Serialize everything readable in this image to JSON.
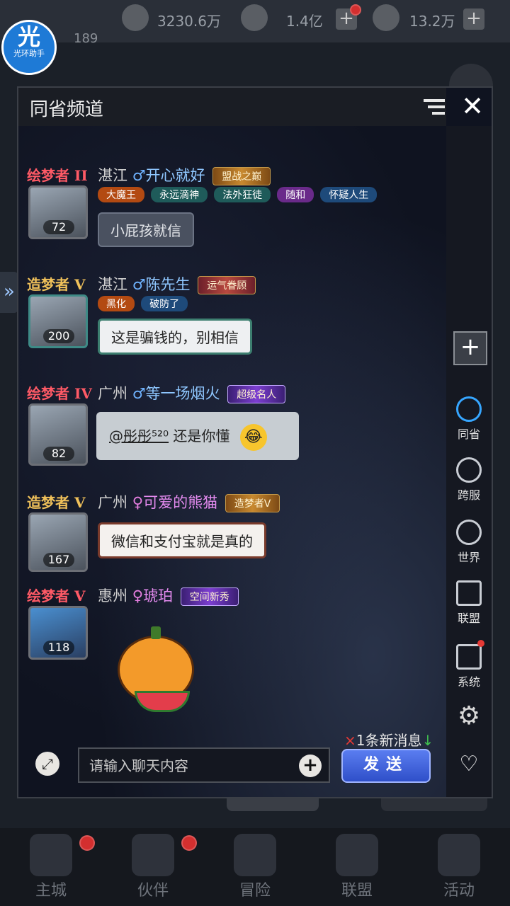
{
  "topbar": {
    "power": "3230.6万",
    "gold": "1.4亿",
    "diamond": "13.2万",
    "level": "189"
  },
  "helper": {
    "icon_text": "光",
    "label": "光环助手"
  },
  "panel": {
    "title": "同省频道"
  },
  "messages": [
    {
      "rank": "绘梦者 II",
      "rank_color": "#ff5a66",
      "city": "湛江",
      "sex": "♂",
      "name": "开心就好",
      "title": "盟战之巅",
      "tags": [
        "大魔王",
        "永远滴神",
        "法外狂徒",
        "随和",
        "怀疑人生"
      ],
      "level": "72",
      "text": "小屁孩就信"
    },
    {
      "rank": "造梦者 V",
      "rank_color": "#f0c15a",
      "city": "湛江",
      "sex": "♂",
      "name": "陈先生",
      "title": "运气眷顾",
      "tags": [
        "黑化",
        "破防了"
      ],
      "level": "200",
      "text": "这是骗钱的，别相信"
    },
    {
      "rank": "绘梦者 IV",
      "rank_color": "#ff5a66",
      "city": "广州",
      "sex": "♂",
      "name": "等一场烟火",
      "title": "超级名人",
      "tags": [],
      "level": "82",
      "mention": "@彤彤⁵²⁰",
      "text": "还是你懂",
      "emoji": "😂"
    },
    {
      "rank": "造梦者 V",
      "rank_color": "#f0c15a",
      "city": "广州",
      "sex": "♀",
      "name": "可爱的熊猫",
      "title": "造梦者Ⅴ",
      "tags": [],
      "level": "167",
      "text": "微信和支付宝就是真的"
    },
    {
      "rank": "绘梦者 V",
      "rank_color": "#ff5a66",
      "city": "惠州",
      "sex": "♀",
      "name": "琥珀",
      "title": "空间新秀",
      "tags": [],
      "level": "118",
      "sticker": "pumpkin-eating-watermelon"
    }
  ],
  "side_nav": [
    {
      "label": "同省",
      "icon": "location-pin-icon",
      "active": true
    },
    {
      "label": "跨服",
      "icon": "planet-icon",
      "active": false
    },
    {
      "label": "世界",
      "icon": "compass-icon",
      "active": false
    },
    {
      "label": "联盟",
      "icon": "banner-icon",
      "active": false
    },
    {
      "label": "系统",
      "icon": "megaphone-icon",
      "active": false
    }
  ],
  "input": {
    "placeholder": "请输入聊天内容",
    "send_label": "发送",
    "new_messages": "1条新消息"
  },
  "tabbar": [
    {
      "label": "主城",
      "icon": "castle-icon"
    },
    {
      "label": "伙伴",
      "icon": "witch-hat-icon"
    },
    {
      "label": "冒险",
      "icon": "compass-rose-icon"
    },
    {
      "label": "联盟",
      "icon": "shield-icon"
    },
    {
      "label": "活动",
      "icon": "cards-icon"
    }
  ]
}
